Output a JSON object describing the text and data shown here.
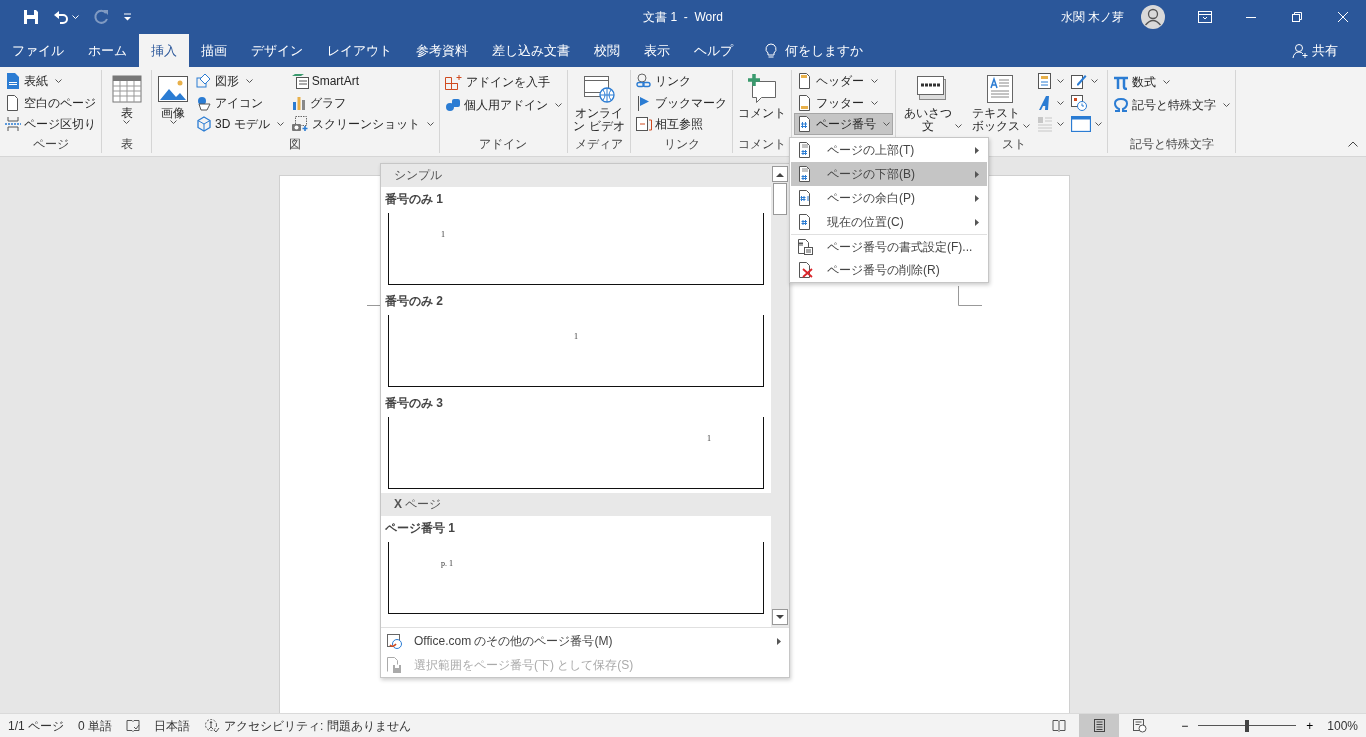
{
  "title_bar": {
    "title": "文書 1  -  Word",
    "user": "水関 木ノ芽"
  },
  "quick_access": [
    {
      "kind": "save",
      "disabled": false
    },
    {
      "kind": "undo",
      "disabled": false
    },
    {
      "kind": "redo",
      "disabled": true
    },
    {
      "kind": "customize",
      "disabled": false
    }
  ],
  "tabs": [
    {
      "label": "ファイル",
      "selected": false
    },
    {
      "label": "ホーム",
      "selected": false
    },
    {
      "label": "挿入",
      "selected": true
    },
    {
      "label": "描画",
      "selected": false
    },
    {
      "label": "デザイン",
      "selected": false
    },
    {
      "label": "レイアウト",
      "selected": false
    },
    {
      "label": "参考資料",
      "selected": false
    },
    {
      "label": "差し込み文書",
      "selected": false
    },
    {
      "label": "校閲",
      "selected": false
    },
    {
      "label": "表示",
      "selected": false
    },
    {
      "label": "ヘルプ",
      "selected": false
    }
  ],
  "tell_me": "何をしますか",
  "share": "共有",
  "ribbon": [
    {
      "label": "ページ",
      "columns": [
        [
          {
            "kind": "small",
            "label": "表紙",
            "dropdown": true
          },
          {
            "kind": "small",
            "label": "空白のページ",
            "dropdown": false
          },
          {
            "kind": "small",
            "label": "ページ区切り",
            "dropdown": false
          }
        ]
      ]
    },
    {
      "label": "表",
      "columns": [
        [
          {
            "kind": "large",
            "label": "表",
            "dropdown": true
          }
        ]
      ]
    },
    {
      "label": "図",
      "columns": [
        [
          {
            "kind": "large",
            "label": "画像",
            "dropdown": true
          }
        ],
        [
          {
            "kind": "small",
            "label": "図形",
            "dropdown": true
          },
          {
            "kind": "small",
            "label": "アイコン",
            "dropdown": false
          },
          {
            "kind": "small",
            "label": "3D モデル",
            "dropdown": true
          }
        ],
        [
          {
            "kind": "small",
            "label": "SmartArt",
            "dropdown": false
          },
          {
            "kind": "small",
            "label": "グラフ",
            "dropdown": false
          },
          {
            "kind": "small",
            "label": "スクリーンショット",
            "dropdown": true
          }
        ]
      ]
    },
    {
      "label": "アドイン",
      "columns": [
        [
          {
            "kind": "small",
            "label": "アドインを入手",
            "dropdown": false
          },
          {
            "kind": "small",
            "label": "個人用アドイン",
            "dropdown": true
          }
        ]
      ]
    },
    {
      "label": "メディア",
      "columns": [
        [
          {
            "kind": "large-wrap",
            "label": "オンライン ビデオ",
            "dropdown": false
          }
        ]
      ]
    },
    {
      "label": "リンク",
      "columns": [
        [
          {
            "kind": "small",
            "label": "リンク",
            "dropdown": false
          },
          {
            "kind": "small",
            "label": "ブックマーク",
            "dropdown": false
          },
          {
            "kind": "small",
            "label": "相互参照",
            "dropdown": false
          }
        ]
      ]
    },
    {
      "label": "コメント",
      "columns": [
        [
          {
            "kind": "large",
            "label": "コメント",
            "dropdown": false
          }
        ]
      ]
    },
    {
      "columns": [
        [
          {
            "kind": "small",
            "label": "ヘッダー",
            "dropdown": true,
            "pressed": false
          },
          {
            "kind": "small",
            "label": "フッター",
            "dropdown": true,
            "pressed": false
          },
          {
            "kind": "small",
            "label": "ページ番号",
            "dropdown": true,
            "pressed": true
          }
        ]
      ]
    },
    {
      "label": "スト",
      "columns": [
        [
          {
            "kind": "large-wrap",
            "label": "あいさつ文",
            "dropdown": true
          }
        ],
        [
          {
            "kind": "large-wrap",
            "label": "テキストボックス",
            "dropdown": true
          }
        ],
        [
          {
            "kind": "icon",
            "dropdown": true,
            "disabled": false
          },
          {
            "kind": "icon",
            "dropdown": true,
            "disabled": false
          },
          {
            "kind": "icon",
            "dropdown": true,
            "disabled": true
          }
        ],
        [
          {
            "kind": "icon",
            "dropdown": true,
            "disabled": false
          },
          {
            "kind": "icon",
            "dropdown": false,
            "disabled": false
          },
          {
            "kind": "icon",
            "dropdown": true,
            "disabled": false
          }
        ]
      ]
    },
    {
      "label": "記号と特殊文字",
      "columns": [
        [
          {
            "kind": "small",
            "label": "数式",
            "dropdown": true
          },
          {
            "kind": "small",
            "label": "記号と特殊文字",
            "dropdown": true
          }
        ]
      ]
    }
  ],
  "gallery": {
    "sections": [
      {
        "heading": "シンプル",
        "entries": [
          {
            "label": "番号のみ 1",
            "preview": "1",
            "kind": "left"
          },
          {
            "label": "番号のみ 2",
            "preview": "1",
            "kind": "center"
          },
          {
            "label": "番号のみ 3",
            "preview": "1",
            "kind": "right"
          }
        ]
      },
      {
        "heading": "**X** ページ",
        "entries": [
          {
            "label": "ページ番号 1",
            "preview": "p. 1",
            "kind": "left"
          }
        ]
      }
    ],
    "footer": [
      {
        "label": "Office.com のその他のページ番号(M)",
        "submenu": true,
        "disabled": false
      },
      {
        "label": "選択範囲をページ番号(下) として保存(S)",
        "submenu": false,
        "disabled": true
      }
    ]
  },
  "page_number_menu": [
    {
      "label": "ページの上部(T)",
      "submenu": true,
      "selected": false,
      "separator_before": false
    },
    {
      "label": "ページの下部(B)",
      "submenu": true,
      "selected": true,
      "separator_before": false
    },
    {
      "label": "ページの余白(P)",
      "submenu": true,
      "selected": false,
      "separator_before": false
    },
    {
      "label": "現在の位置(C)",
      "submenu": true,
      "selected": false,
      "separator_before": false
    },
    {
      "label": "ページ番号の書式設定(F)...",
      "submenu": false,
      "selected": false,
      "separator_before": true
    },
    {
      "label": "ページ番号の削除(R)",
      "submenu": false,
      "selected": false,
      "separator_before": false
    }
  ],
  "status_bar": {
    "page": "1/1 ページ",
    "words": "0 単語",
    "language": "日本語",
    "accessibility": "アクセシビリティ: 問題ありません",
    "views": [
      {
        "kind": "read",
        "selected": false
      },
      {
        "kind": "print",
        "selected": true
      },
      {
        "kind": "web",
        "selected": false
      }
    ],
    "zoom_out": "−",
    "zoom_in": "+",
    "zoom": {
      "level": 0.5,
      "reading": "100%"
    }
  }
}
